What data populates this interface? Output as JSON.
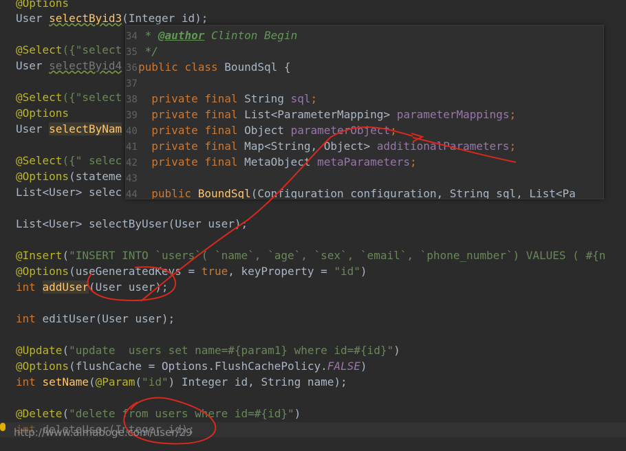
{
  "code": {
    "l01": {
      "ann": "@Options"
    },
    "l02": {
      "type": "User ",
      "method": "selectByid3",
      "args": "(Integer id);"
    },
    "l03": {
      "ann": "@Select",
      "rest": "({\"select"
    },
    "l04": {
      "type": "User ",
      "method": "selectByid4"
    },
    "l05": {
      "ann": "@Select",
      "rest": "({\"select"
    },
    "l06": {
      "ann": "@Options"
    },
    "l07": {
      "type": "User ",
      "method": "selectByNam"
    },
    "l08": {
      "ann": "@Select",
      "rest": "({\" selec"
    },
    "l09": {
      "ann": "@Options",
      "rest": "(stateme"
    },
    "l10": {
      "text": "List<User> selec"
    },
    "l11": {
      "text": "List<User> selectByUser(User user);"
    },
    "l12": {
      "ann": "@Insert",
      "open": "(",
      "str": "\"INSERT INTO `users`( `name`, `age`, `sex`, `email`, `phone_number`) VALUES ( #{n"
    },
    "l13": {
      "ann": "@Options",
      "p1": "(useGeneratedKeys = ",
      "kw": "true",
      "p2": ", keyProperty = ",
      "str": "\"id\"",
      "p3": ")"
    },
    "l14": {
      "kw": "int ",
      "method": "addUser",
      "args": "(User user);"
    },
    "l15": {
      "kw": "int ",
      "args": "editUser(User user);"
    },
    "l16": {
      "ann": "@Update",
      "open": "(",
      "str": "\"update  users set name=#{param1} where id=#{id}\"",
      "close": ")"
    },
    "l17": {
      "ann": "@Options",
      "p1": "(flushCache = ",
      "p2": "Options.FlushCachePolicy.",
      "fld": "FALSE",
      "p3": ")"
    },
    "l18": {
      "kw": "int ",
      "method": "setName",
      "p1": "(",
      "ann": "@Param",
      "p2": "(",
      "str": "\"id\"",
      "p3": ") Integer id, String name);"
    },
    "l19": {
      "ann": "@Delete",
      "open": "(",
      "str": "\"delete from users where id=#{id}\"",
      "close": ")"
    },
    "l20": {
      "kw": "int ",
      "args": "deleteUser(Integer id);"
    }
  },
  "popup": {
    "lines": [
      {
        "num": "34",
        "doc": " * ",
        "tag": "@author",
        "rest": " Clinton Begin"
      },
      {
        "num": "35",
        "doc": " */"
      },
      {
        "num": "36",
        "kw": "public class ",
        "text": "BoundSql {"
      },
      {
        "num": "37"
      },
      {
        "num": "38",
        "kw": "  private final ",
        "type": "String ",
        "fld": "sql",
        "end": ";"
      },
      {
        "num": "39",
        "kw": "  private final ",
        "type": "List<ParameterMapping> ",
        "fld": "parameterMappings",
        "end": ";"
      },
      {
        "num": "40",
        "kw": "  private final ",
        "type": "Object ",
        "fld": "parameterObject",
        "end": ";"
      },
      {
        "num": "41",
        "kw": "  private final ",
        "type": "Map<String, Object> ",
        "fld": "additionalParameters",
        "end": ";"
      },
      {
        "num": "42",
        "kw": "  private final ",
        "type": "MetaObject ",
        "fld": "metaParameters",
        "end": ";"
      },
      {
        "num": "43"
      },
      {
        "num": "44",
        "kw": "  public ",
        "fn": "BoundSql",
        "text": "(Configuration configuration, String sql, List<Pa"
      }
    ]
  },
  "watermark": "http://www.aimaboge.com/user/29"
}
